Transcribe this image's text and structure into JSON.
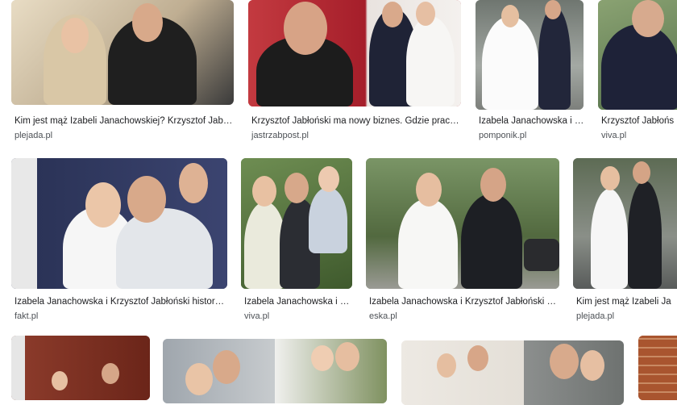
{
  "results": [
    {
      "title": "Kim jest mąż Izabeli Janachowskiej? Krzysztof Jab…",
      "source": "plejada.pl"
    },
    {
      "title": "Krzysztof Jabłoński ma nowy biznes. Gdzie prac…",
      "source": "jastrzabpost.pl"
    },
    {
      "title": "Izabela Janachowska i …",
      "source": "pomponik.pl"
    },
    {
      "title": "Krzysztof Jabłońs",
      "source": "viva.pl"
    },
    {
      "title": "Izabela Janachowska i Krzysztof Jabłoński histor…",
      "source": "fakt.pl"
    },
    {
      "title": "Izabela Janachowska i …",
      "source": "viva.pl"
    },
    {
      "title": "Izabela Janachowska i Krzysztof Jabłoński …",
      "source": "eska.pl"
    },
    {
      "title": "Kim jest mąż Izabeli Ja",
      "source": "plejada.pl"
    },
    {
      "title": "",
      "source": ""
    },
    {
      "title": "",
      "source": ""
    },
    {
      "title": "",
      "source": ""
    },
    {
      "title": "",
      "source": ""
    }
  ]
}
